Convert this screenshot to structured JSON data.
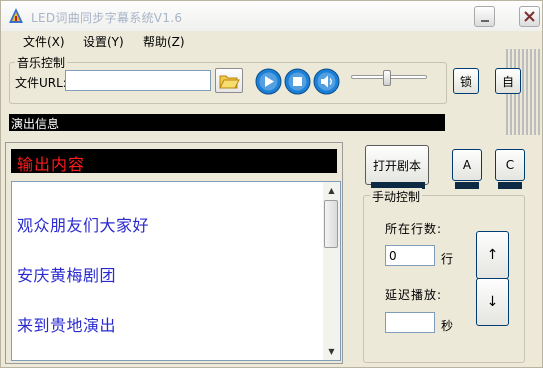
{
  "window": {
    "title": "LED词曲同步字幕系统V1.6"
  },
  "menu": [
    {
      "label": "文件(X)"
    },
    {
      "label": "设置(Y)"
    },
    {
      "label": "帮助(Z)"
    }
  ],
  "music_control": {
    "legend": "音乐控制",
    "file_label": "文件URL:",
    "file_value": "",
    "volume_level": 0.45
  },
  "side_buttons": {
    "lock_label": "锁",
    "auto_label": "自"
  },
  "performance": {
    "label": "演出信息"
  },
  "output": {
    "header": "输出内容",
    "lines": [
      "观众朋友们大家好",
      "安庆黄梅剧团",
      "来到贵地演出"
    ]
  },
  "script": {
    "open_label": "打开剧本",
    "a_label": "A",
    "c_label": "C"
  },
  "manual": {
    "legend": "手动控制",
    "line_label": "所在行数:",
    "line_value": "0",
    "line_unit": "行",
    "delay_label": "延迟播放:",
    "delay_value": "",
    "delay_unit": "秒",
    "up_glyph": "↑",
    "down_glyph": "↓"
  },
  "colors": {
    "output_header_text": "#ff1a1a",
    "lyric_text": "#2a2ad0",
    "media_button": "#1a7fd6"
  }
}
